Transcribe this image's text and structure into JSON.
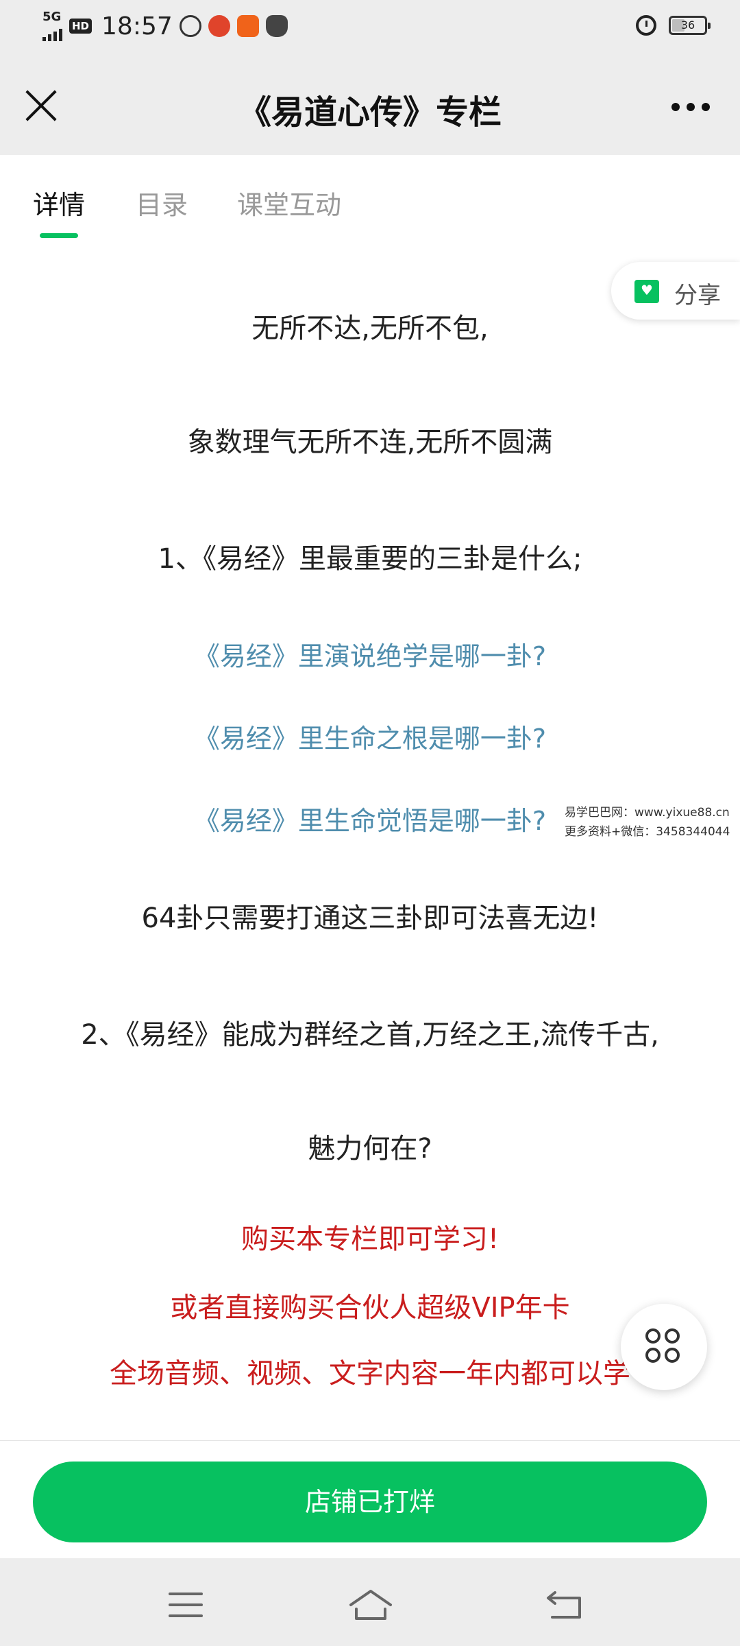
{
  "status_bar": {
    "network": "5G",
    "hd": "HD",
    "time": "18:57",
    "battery": "36",
    "app_icons": [
      "cloud-app-icon",
      "pumpkin-app-icon",
      "taobao-app-icon",
      "cat-app-icon"
    ]
  },
  "nav": {
    "title": "《易道心传》专栏"
  },
  "tabs": [
    {
      "label": "详情",
      "active": true
    },
    {
      "label": "目录",
      "active": false
    },
    {
      "label": "课堂互动",
      "active": false
    }
  ],
  "share": {
    "label": "分享"
  },
  "article": {
    "lines": [
      "无所不达,无所不包,",
      "象数理气无所不连,无所不圆满",
      "1、《易经》里最重要的三卦是什么;",
      "《易经》里演说绝学是哪一卦?",
      "《易经》里生命之根是哪一卦?",
      "《易经》里生命觉悟是哪一卦?",
      "64卦只需要打通这三卦即可法喜无边!",
      "2、《易经》能成为群经之首,万经之王,流传千古,",
      "魅力何在?",
      "购买本专栏即可学习!",
      "或者直接购买合伙人超级VIP年卡",
      "全场音频、视频、文字内容一年内都可以学"
    ]
  },
  "watermark": {
    "line1": "易学巴巴网：www.yixue88.cn",
    "line2": "更多资料+微信：3458344044"
  },
  "bottom": {
    "button_label": "店铺已打烊"
  },
  "colors": {
    "accent_green": "#07c160",
    "question_blue": "#4f8dad",
    "promo_red": "#c91d1d"
  }
}
